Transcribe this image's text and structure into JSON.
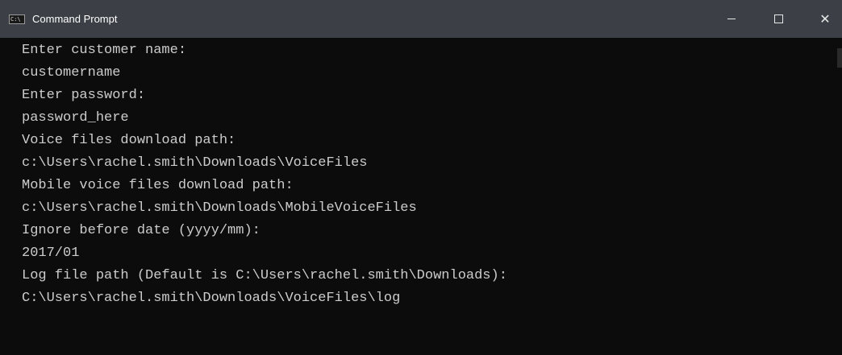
{
  "window": {
    "title": "Command Prompt",
    "icon": "cmd-icon",
    "icon_text": "C:\\",
    "controls": {
      "minimize": "minimize-icon",
      "maximize": "maximize-icon",
      "close": "close-icon",
      "close_glyph": "✕"
    }
  },
  "console": {
    "lines": [
      "Enter customer name:",
      "customername",
      "Enter password:",
      "password_here",
      "Voice files download path:",
      "c:\\Users\\rachel.smith\\Downloads\\VoiceFiles",
      "Mobile voice files download path:",
      "c:\\Users\\rachel.smith\\Downloads\\MobileVoiceFiles",
      "Ignore before date (yyyy/mm):",
      "2017/01",
      "Log file path (Default is C:\\Users\\rachel.smith\\Downloads):",
      "C:\\Users\\rachel.smith\\Downloads\\VoiceFiles\\log"
    ],
    "colors": {
      "background": "#0c0c0c",
      "foreground": "#cccccc",
      "titlebar": "#3c3f45"
    }
  }
}
